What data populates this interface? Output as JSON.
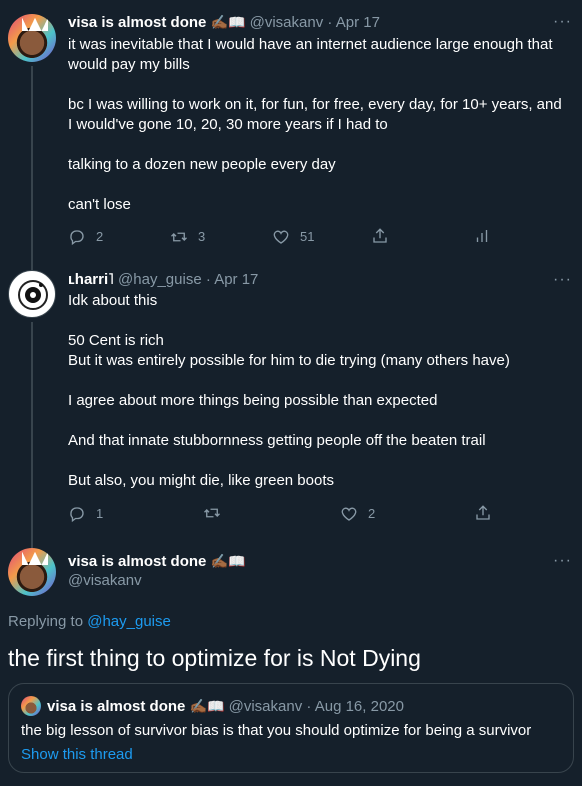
{
  "tweet1": {
    "name": "visa is almost done",
    "badge": "✍🏾📖",
    "handle": "@visakanv",
    "date": "Apr 17",
    "separator": "·",
    "paragraphs": [
      "it was inevitable that I would have an internet audience large enough that would pay my bills",
      "bc I was willing to work on it, for fun, for free, every day, for 10+ years, and I would've gone 10, 20, 30 more years if I had to",
      "talking to a dozen new people every day",
      "can't lose"
    ],
    "actions": {
      "replies": "2",
      "retweets": "3",
      "likes": "51"
    }
  },
  "tweet2": {
    "name": "ʟharri˥",
    "handle": "@hay_guise",
    "date": "Apr 17",
    "separator": "·",
    "paragraphs": [
      "Idk about this",
      "50 Cent is rich\nBut it was entirely possible for him to die trying (many others have)",
      "I agree about more things being possible than expected",
      "And that innate stubbornness getting people off the beaten trail",
      "But also, you might die, like green boots"
    ],
    "actions": {
      "replies": "1",
      "retweets": "",
      "likes": "2"
    }
  },
  "tweet3": {
    "name": "visa is almost done",
    "badge": "✍🏾📖",
    "handle": "@visakanv",
    "replying_prefix": "Replying to ",
    "replying_to": "@hay_guise",
    "text": "the first thing to optimize for is Not Dying",
    "quote": {
      "name": "visa is almost done",
      "badge": "✍🏾📖",
      "handle": "@visakanv",
      "separator": "·",
      "date": "Aug 16, 2020",
      "text": "the big lesson of survivor bias is that you should optimize for being a survivor",
      "link": "Show this thread"
    }
  },
  "more_label": "···",
  "colors": {
    "background": "#15202b",
    "muted": "#8899a6",
    "accent": "#1d9bf0",
    "border": "#38444d"
  }
}
